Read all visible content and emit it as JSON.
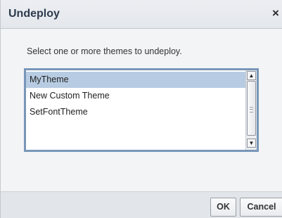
{
  "dialog": {
    "title": "Undeploy",
    "close_glyph": "×",
    "close_icon": "close-icon"
  },
  "instruction": "Select one or more themes to undeploy.",
  "theme_list": {
    "items": [
      {
        "label": "MyTheme",
        "selected": true
      },
      {
        "label": "New Custom Theme",
        "selected": false
      },
      {
        "label": "SetFontTheme",
        "selected": false
      }
    ],
    "scroll_up_glyph": "▲",
    "scroll_down_glyph": "▼"
  },
  "buttons": {
    "ok_label": "OK",
    "cancel_label": "Cancel"
  },
  "colors": {
    "title_text": "#2d3b4e",
    "selection": "#b7cce2",
    "list_border": "#7896b8"
  }
}
